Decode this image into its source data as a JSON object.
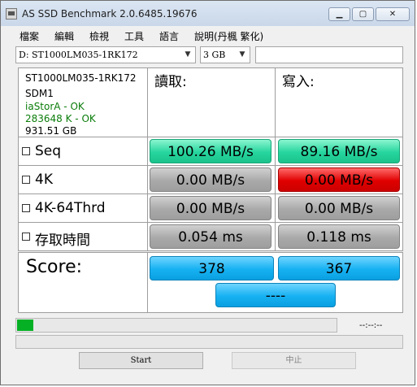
{
  "window": {
    "title": "AS SSD Benchmark 2.0.6485.19676",
    "minimize": "▁",
    "maximize": "▢",
    "close": "✕"
  },
  "menu": [
    "檔案",
    "編輯",
    "檢視",
    "工具",
    "語言",
    "說明(丹楓 繁化)"
  ],
  "drive_select": {
    "value": "D: ST1000LM035-1RK172"
  },
  "size_select": {
    "value": "3 GB"
  },
  "extra_input": {
    "value": ""
  },
  "drive_info": {
    "model": "ST1000LM035-1RK172",
    "firmware": "SDM1",
    "driver": "iaStorA - OK",
    "alignment": "283648 K - OK",
    "capacity": "931.51 GB"
  },
  "headers": {
    "read": "讀取:",
    "write": "寫入:"
  },
  "rows": [
    {
      "label": "Seq",
      "read": "100.26 MB/s",
      "write": "89.16 MB/s"
    },
    {
      "label": "4K",
      "read": "0.00 MB/s",
      "write": "0.00 MB/s"
    },
    {
      "label": "4K-64Thrd",
      "read": "0.00 MB/s",
      "write": "0.00 MB/s"
    },
    {
      "label": "存取時間",
      "read": "0.054 ms",
      "write": "0.118 ms"
    }
  ],
  "score": {
    "label": "Score:",
    "read": "378",
    "write": "367",
    "total": "----"
  },
  "progress": {
    "fraction": 0.05,
    "time": "--:--:--"
  },
  "buttons": {
    "start": "Start",
    "stop": "中止"
  },
  "colors": {
    "ok_text": "#0a7d0a",
    "green": "#26d59e",
    "red": "#e00000",
    "blue": "#16b1f2",
    "gray": "#a9a9a9",
    "progress": "#06b025"
  }
}
